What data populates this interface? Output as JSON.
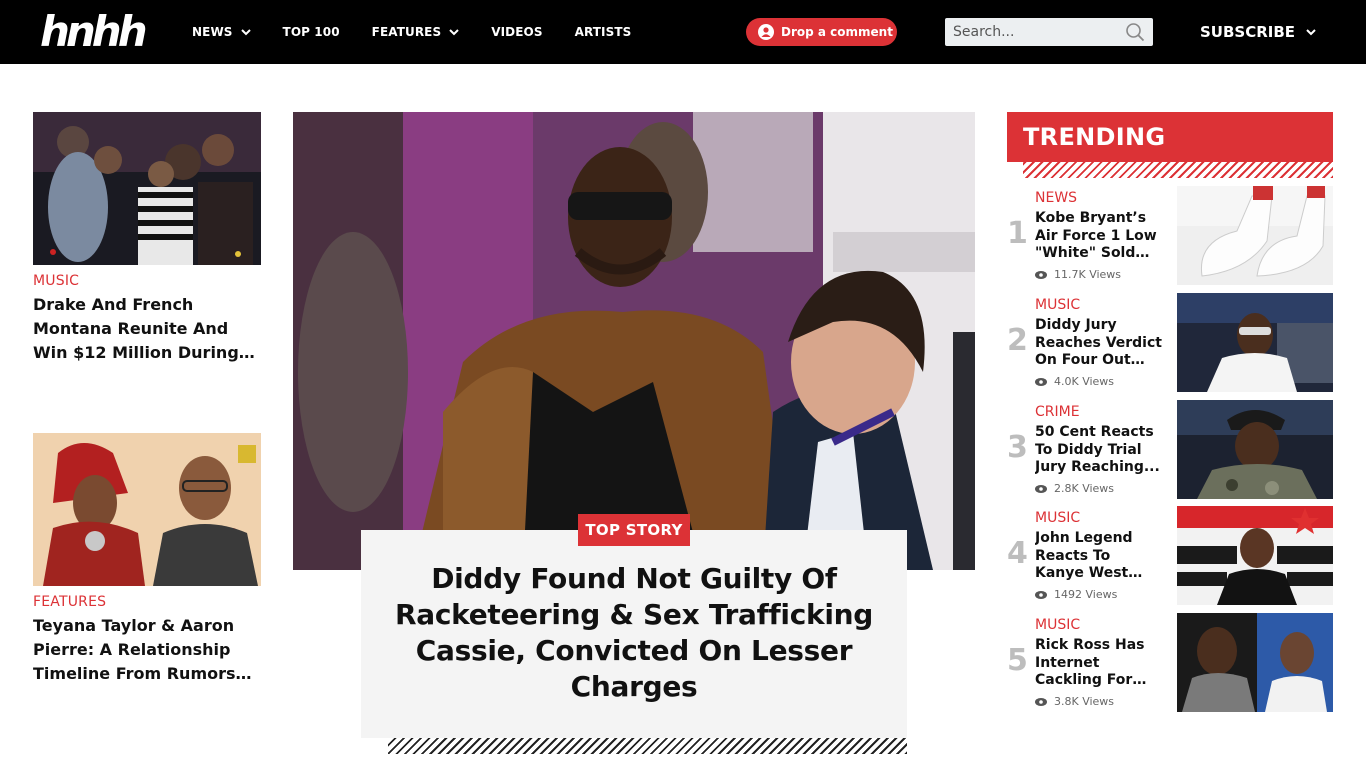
{
  "header": {
    "logo": "hnhh",
    "nav": [
      {
        "label": "NEWS",
        "has_dropdown": true
      },
      {
        "label": "TOP 100",
        "has_dropdown": false
      },
      {
        "label": "FEATURES",
        "has_dropdown": true
      },
      {
        "label": "VIDEOS",
        "has_dropdown": false
      },
      {
        "label": "ARTISTS",
        "has_dropdown": false
      }
    ],
    "comment_button": "Drop a comment",
    "search_placeholder": "Search...",
    "subscribe": "SUBSCRIBE"
  },
  "left_column": [
    {
      "category": "MUSIC",
      "title": "Drake And French Montana Reunite And Win $12 Million During Kick Stream",
      "image": "photo-drake-french-montana"
    },
    {
      "category": "FEATURES",
      "title": "Teyana Taylor & Aaron Pierre: A Relationship Timeline From Rumors To...",
      "image": "photo-teyana-taylor-aaron-pierre"
    }
  ],
  "hero": {
    "badge": "TOP STORY",
    "title": "Diddy Found Not Guilty Of Racketeering & Sex Trafficking Cassie, Convicted On Lesser Charges",
    "image": "photo-diddy-fur-coat"
  },
  "trending": {
    "heading": "TRENDING",
    "items": [
      {
        "rank": "1",
        "category": "NEWS",
        "title": "Kobe Bryant’s Air Force 1 Low \"White\" Sold Ou...",
        "views": "11.7K Views",
        "image": "photo-white-sneakers"
      },
      {
        "rank": "2",
        "category": "MUSIC",
        "title": "Diddy Jury Reaches Verdict On Four Out Of...",
        "views": "4.0K Views",
        "image": "photo-diddy-studio"
      },
      {
        "rank": "3",
        "category": "CRIME",
        "title": "50 Cent Reacts To Diddy Trial Jury Reaching...",
        "views": "2.8K Views",
        "image": "photo-50-cent"
      },
      {
        "rank": "4",
        "category": "MUSIC",
        "title": "John Legend Reacts To Kanye West Saying He...",
        "views": "1492 Views",
        "image": "photo-john-legend"
      },
      {
        "rank": "5",
        "category": "MUSIC",
        "title": "Rick Ross Has Internet Cackling For This Image...",
        "views": "3.8K Views",
        "image": "photo-rick-ross-drake"
      }
    ]
  },
  "colors": {
    "brand_red": "#dc3236",
    "header_bg": "#000000"
  }
}
